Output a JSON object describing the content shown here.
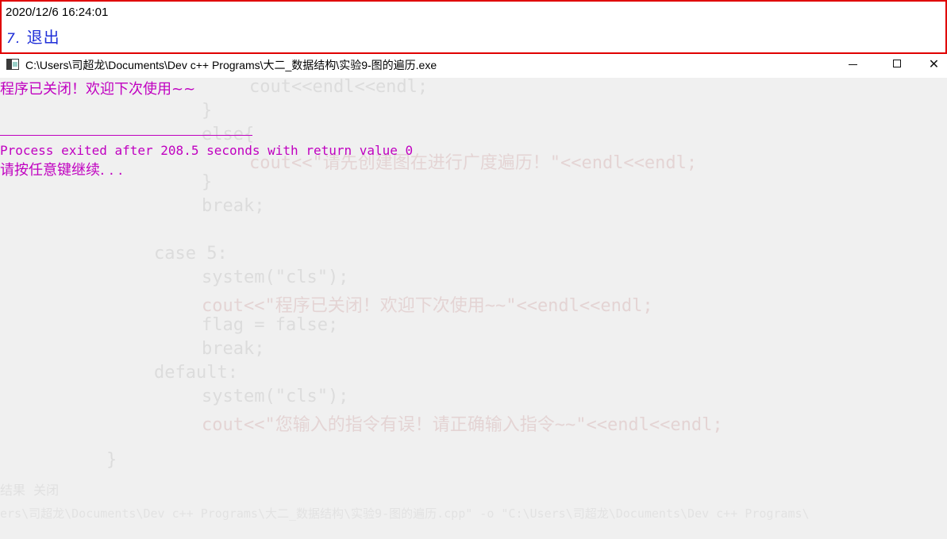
{
  "overlay": {
    "timestamp": "2020/12/6 16:24:01",
    "menu_item_number": "7.",
    "menu_item_label": "退出"
  },
  "window": {
    "title": "C:\\Users\\司超龙\\Documents\\Dev c++ Programs\\大二_数据结构\\实验9-图的遍历.exe",
    "icon": "console-app-icon",
    "close_glyph": "✕"
  },
  "console": {
    "line1": "程序已关闭！欢迎下次使用~~",
    "line2": "Process exited after 208.5 seconds with return value 0",
    "line3": "请按任意键继续. . ."
  },
  "background_code": {
    "l1": "cout<<endl<<endl;",
    "l2": "}",
    "l3": "else{",
    "l4": "cout<<\"请先创建图在进行广度遍历！\"<<endl<<endl;",
    "l5": "}",
    "l6": "break;",
    "l7": "case 5:",
    "l8": "system(\"cls\");",
    "l9": "cout<<\"程序已关闭！欢迎下次使用~~\"<<endl<<endl;",
    "l10": "flag = false;",
    "l11": "break;",
    "l12": "default:",
    "l13": "system(\"cls\");",
    "l14": "cout<<\"您输入的指令有误！请正确输入指令~~\"<<endl<<endl;",
    "l15": "}",
    "tabs": "结果  关闭",
    "compile_cmd": "ers\\司超龙\\Documents\\Dev c++ Programs\\大二_数据结构\\实验9-图的遍历.cpp\" -o \"C:\\Users\\司超龙\\Documents\\Dev c++ Programs\\"
  },
  "colors": {
    "console_text": "#c000c0",
    "overlay_border": "#e00000",
    "menu_text": "#1f2fd8"
  }
}
